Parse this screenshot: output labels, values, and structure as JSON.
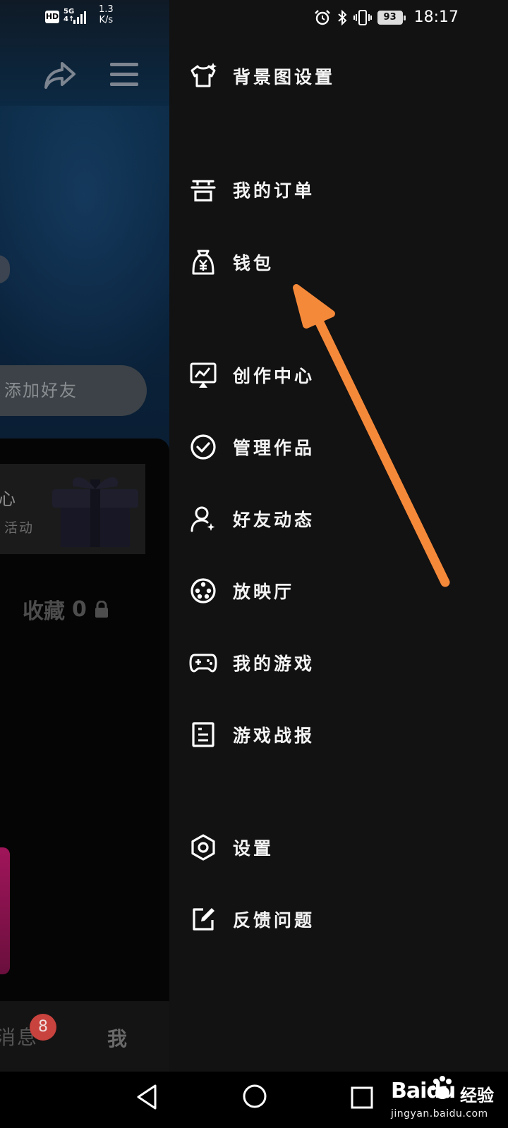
{
  "status_bar": {
    "hd_label": "HD",
    "network_label": "5G",
    "network_sub": "4↑",
    "speed_value": "1.3",
    "speed_unit": "K/s",
    "battery": "93",
    "time": "18:17"
  },
  "background_page": {
    "add_friend": "添加好友",
    "card_title": "心",
    "card_subtitle": "活动",
    "favorites_label": "收藏",
    "favorites_count": "0",
    "nav_messages": "消息",
    "nav_messages_badge": "8",
    "nav_me": "我"
  },
  "drawer": {
    "items": [
      {
        "label": "背景图设置",
        "icon": "tshirt-sparkle-icon"
      },
      {
        "label": "我的订单",
        "icon": "order-icon"
      },
      {
        "label": "钱包",
        "icon": "wallet-icon"
      },
      {
        "label": "创作中心",
        "icon": "creator-icon"
      },
      {
        "label": "管理作品",
        "icon": "check-circle-icon"
      },
      {
        "label": "好友动态",
        "icon": "friend-activity-icon"
      },
      {
        "label": "放映厅",
        "icon": "film-reel-icon"
      },
      {
        "label": "我的游戏",
        "icon": "gamepad-icon"
      },
      {
        "label": "游戏战报",
        "icon": "report-icon"
      },
      {
        "label": "设置",
        "icon": "settings-hex-icon"
      },
      {
        "label": "反馈问题",
        "icon": "edit-square-icon"
      }
    ]
  },
  "annotation": {
    "color": "#f5893a"
  },
  "watermark": {
    "brand": "Baidu",
    "brand_cn": "经验",
    "url": "jingyan.baidu.com"
  }
}
